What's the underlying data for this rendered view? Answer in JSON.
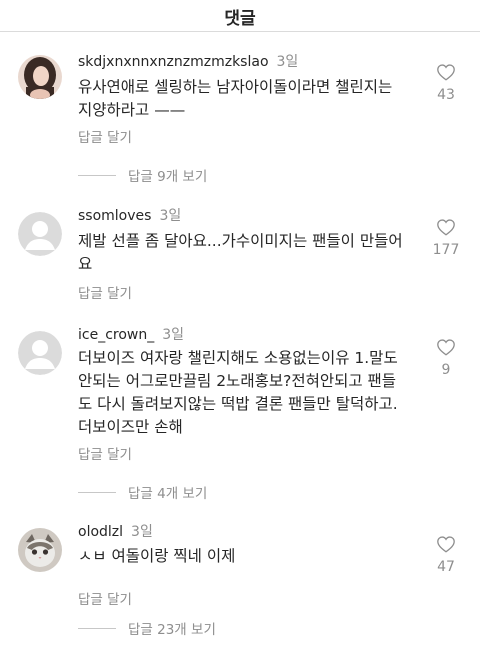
{
  "header": {
    "title": "댓글"
  },
  "comments": [
    {
      "username": "skdjxnxnnxnznzmzmzkslao",
      "time": "3일",
      "avatar_icon": "user-photo-avatar",
      "text": "유사연애로 셀링하는 남자아이돌이라면 챌린지는\n지양하라고 ——",
      "reply_label": "답글 달기",
      "likes": "43",
      "view_replies": "답글 9개 보기"
    },
    {
      "username": "ssomloves",
      "time": "3일",
      "avatar_icon": "default-profile-avatar",
      "text": "제발 선플 좀 달아요...가수이미지는 팬들이 만들어\n요",
      "reply_label": "답글 달기",
      "likes": "177",
      "view_replies": ""
    },
    {
      "username": "ice_crown_",
      "time": "3일",
      "avatar_icon": "default-profile-avatar",
      "text": "더보이즈 여자랑 챌린지해도 소용없는이유 1.말도\n안되는 어그로만끌림 2노래홍보?전혀안되고 팬들\n도 다시 돌려보지않는 떡밥 결론 팬들만 탈덕하고.\n더보이즈만 손해",
      "reply_label": "답글 달기",
      "likes": "9",
      "view_replies": "답글 4개 보기"
    },
    {
      "username": "olodlzl",
      "time": "3일",
      "avatar_icon": "cat-photo-avatar",
      "text": "ㅅㅂ 여돌이랑 찍네 이제",
      "reply_label": "답글 달기",
      "likes": "47",
      "view_replies": "답글 23개 보기"
    }
  ]
}
